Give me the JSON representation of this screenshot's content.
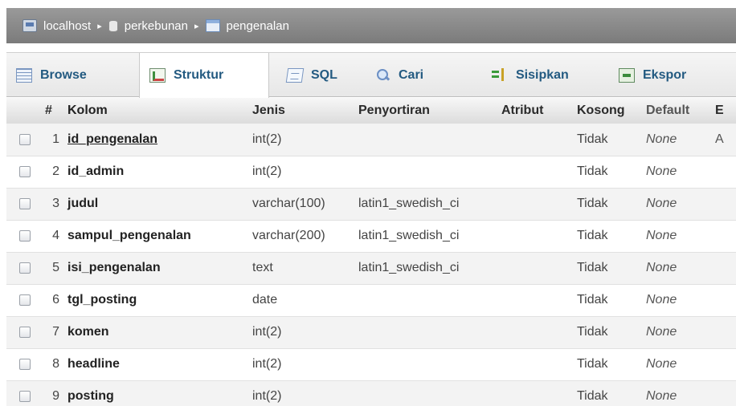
{
  "breadcrumb": {
    "items": [
      {
        "label": "localhost",
        "icon": "server-icon"
      },
      {
        "label": "perkebunan",
        "icon": "database-icon"
      },
      {
        "label": "pengenalan",
        "icon": "table-icon"
      }
    ],
    "separator": "▸"
  },
  "tabs": [
    {
      "label": "Browse",
      "icon": "browse-icon",
      "active": false
    },
    {
      "label": "Struktur",
      "icon": "structure-icon",
      "active": true
    },
    {
      "label": "SQL",
      "icon": "sql-icon",
      "active": false
    },
    {
      "label": "Cari",
      "icon": "search-icon",
      "active": false
    },
    {
      "label": "Sisipkan",
      "icon": "insert-icon",
      "active": false
    },
    {
      "label": "Ekspor",
      "icon": "export-icon",
      "active": false
    }
  ],
  "columns_header": [
    "#",
    "Kolom",
    "Jenis",
    "Penyortiran",
    "Atribut",
    "Kosong",
    "Default",
    "E"
  ],
  "rows": [
    {
      "num": "1",
      "name": "id_pengenalan",
      "type": "int(2)",
      "collation": "",
      "attribute": "",
      "null": "Tidak",
      "default": "None",
      "extra": "A",
      "primary": true
    },
    {
      "num": "2",
      "name": "id_admin",
      "type": "int(2)",
      "collation": "",
      "attribute": "",
      "null": "Tidak",
      "default": "None",
      "extra": "",
      "primary": false
    },
    {
      "num": "3",
      "name": "judul",
      "type": "varchar(100)",
      "collation": "latin1_swedish_ci",
      "attribute": "",
      "null": "Tidak",
      "default": "None",
      "extra": "",
      "primary": false
    },
    {
      "num": "4",
      "name": "sampul_pengenalan",
      "type": "varchar(200)",
      "collation": "latin1_swedish_ci",
      "attribute": "",
      "null": "Tidak",
      "default": "None",
      "extra": "",
      "primary": false
    },
    {
      "num": "5",
      "name": "isi_pengenalan",
      "type": "text",
      "collation": "latin1_swedish_ci",
      "attribute": "",
      "null": "Tidak",
      "default": "None",
      "extra": "",
      "primary": false
    },
    {
      "num": "6",
      "name": "tgl_posting",
      "type": "date",
      "collation": "",
      "attribute": "",
      "null": "Tidak",
      "default": "None",
      "extra": "",
      "primary": false
    },
    {
      "num": "7",
      "name": "komen",
      "type": "int(2)",
      "collation": "",
      "attribute": "",
      "null": "Tidak",
      "default": "None",
      "extra": "",
      "primary": false
    },
    {
      "num": "8",
      "name": "headline",
      "type": "int(2)",
      "collation": "",
      "attribute": "",
      "null": "Tidak",
      "default": "None",
      "extra": "",
      "primary": false
    },
    {
      "num": "9",
      "name": "posting",
      "type": "int(2)",
      "collation": "",
      "attribute": "",
      "null": "Tidak",
      "default": "None",
      "extra": "",
      "primary": false
    }
  ],
  "colors": {
    "tab_text": "#235a81",
    "breadcrumb_bg": "#8a8a8a"
  }
}
